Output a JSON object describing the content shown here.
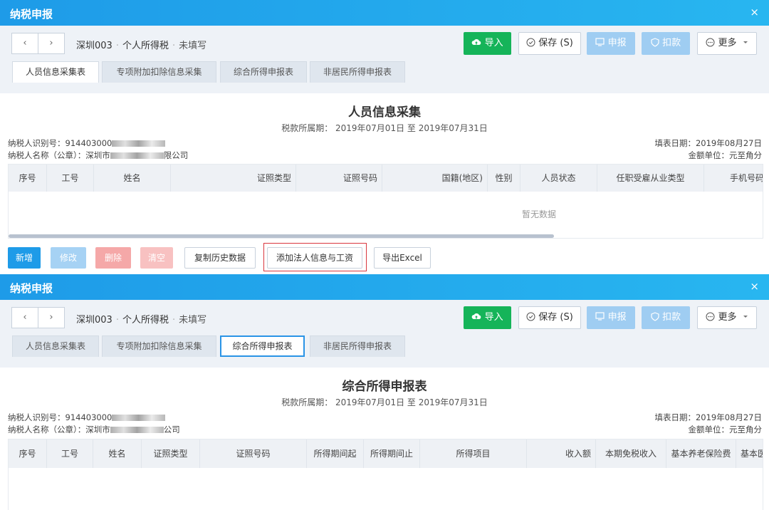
{
  "panel1": {
    "title": "纳税申报",
    "close": "×",
    "nav": {
      "back": "‹",
      "forward": "›"
    },
    "crumb": {
      "company": "深圳003",
      "sep": "·",
      "tax": "个人所得税",
      "status": "未填写"
    },
    "buttons": {
      "import": "导入",
      "save": "保存 (S)",
      "report": "申报",
      "deduct": "扣款",
      "more": "更多"
    },
    "tabs": [
      "人员信息采集表",
      "专项附加扣除信息采集",
      "综合所得申报表",
      "非居民所得申报表"
    ],
    "report_title": "人员信息采集",
    "period": "税款所属期： 2019年07月01日  至  2019年07月31日",
    "taxpayer_id": "纳税人识别号：914403000",
    "taxpayer_name_prefix": "纳税人名称（公章）：深圳市",
    "taxpayer_name_suffix": "限公司",
    "fill_date": "填表日期：2019年08月27日",
    "unit": "金额单位：元至角分",
    "columns": [
      "序号",
      "工号",
      "姓名",
      "证照类型",
      "证照号码",
      "国籍(地区)",
      "性别",
      "人员状态",
      "任职受雇从业类型",
      "手机号码"
    ],
    "empty": "暂无数据",
    "actions": {
      "new": "新增",
      "edit": "修改",
      "delete": "删除",
      "clear": "清空",
      "copy": "复制历史数据",
      "add": "添加法人信息与工资",
      "excel": "导出Excel"
    }
  },
  "panel2": {
    "title": "纳税申报",
    "close": "×",
    "nav": {
      "back": "‹",
      "forward": "›"
    },
    "crumb": {
      "company": "深圳003",
      "sep": "·",
      "tax": "个人所得税",
      "status": "未填写"
    },
    "buttons": {
      "import": "导入",
      "save": "保存 (S)",
      "report": "申报",
      "deduct": "扣款",
      "more": "更多"
    },
    "tabs": [
      "人员信息采集表",
      "专项附加扣除信息采集",
      "综合所得申报表",
      "非居民所得申报表"
    ],
    "report_title": "综合所得申报表",
    "period": "税款所属期： 2019年07月01日  至  2019年07月31日",
    "taxpayer_id": "纳税人识别号：914403000",
    "taxpayer_name_prefix": "纳税人名称（公章）：深圳市",
    "taxpayer_name_suffix": "公司",
    "fill_date": "填表日期：2019年08月27日",
    "unit": "金额单位：元至角分",
    "columns": [
      "序号",
      "工号",
      "姓名",
      "证照类型",
      "证照号码",
      "所得期间起",
      "所得期间止",
      "所得项目",
      "收入额",
      "本期免税收入",
      "基本养老保险费",
      "基本医"
    ]
  },
  "icons": {
    "import": "cloud-upload-icon",
    "save": "check-circle-icon",
    "report": "monitor-icon",
    "deduct": "shield-icon",
    "more": "more-circle-icon",
    "dropdown": "chevron-down-icon"
  }
}
